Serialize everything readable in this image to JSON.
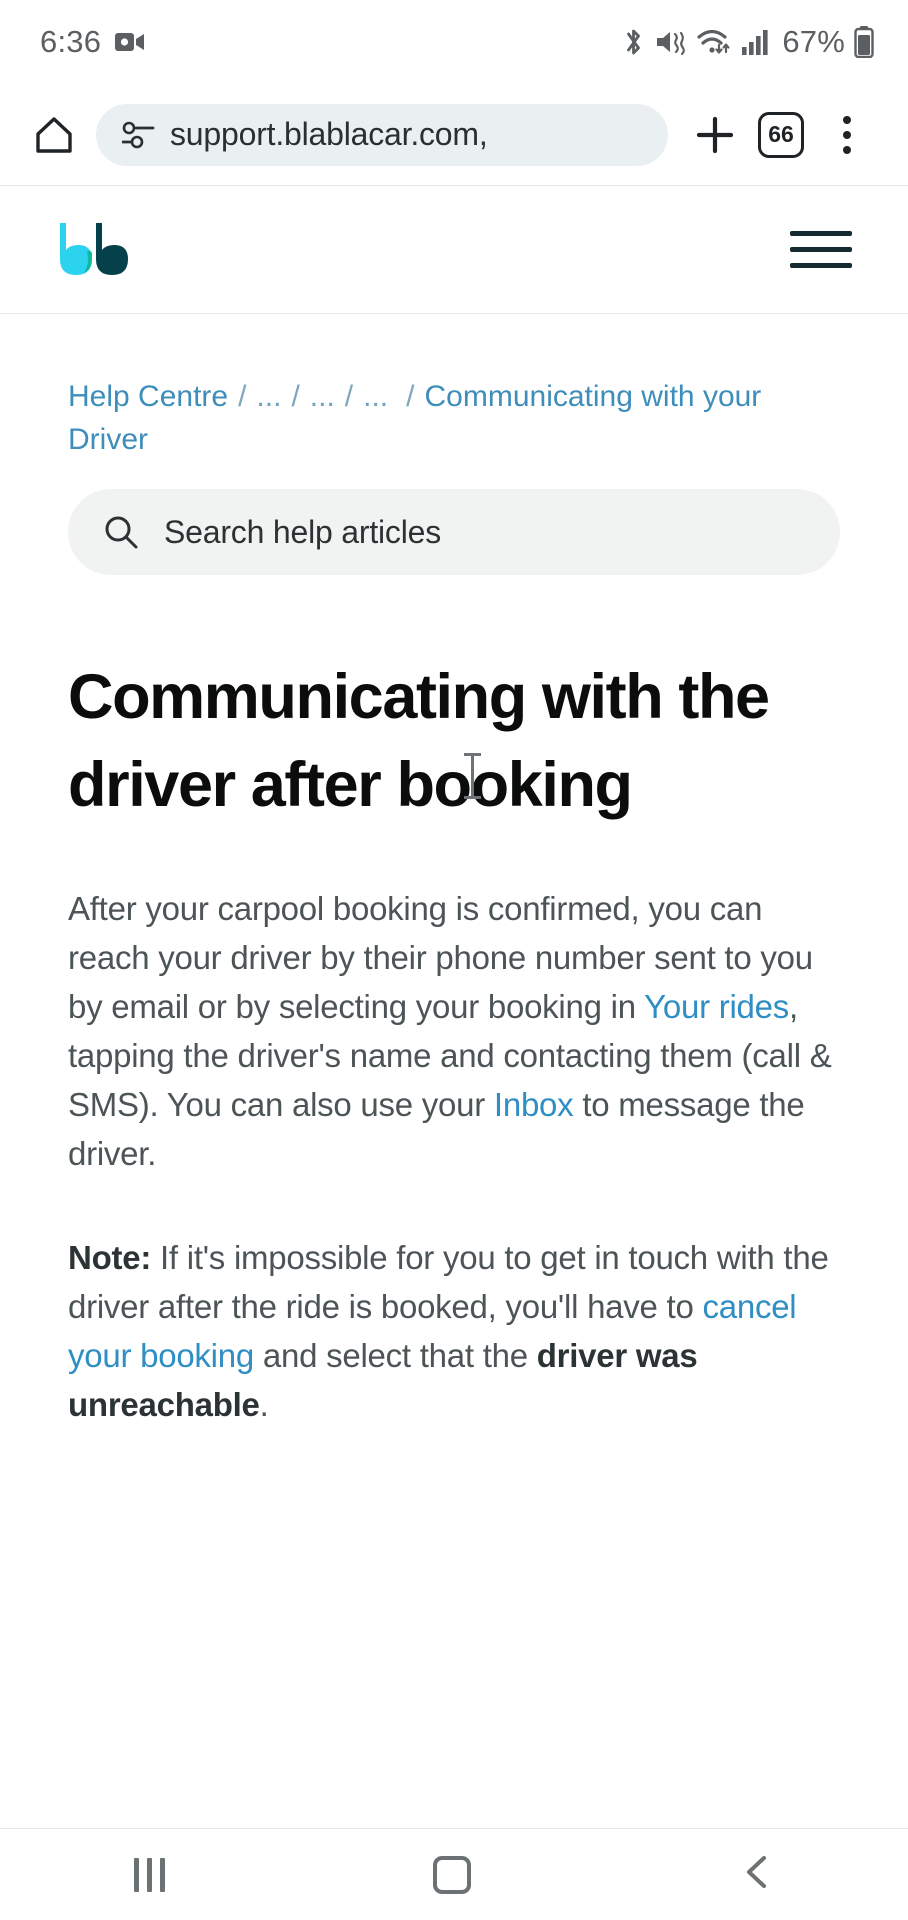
{
  "status_bar": {
    "time": "6:36",
    "battery_text": "67%",
    "icons": [
      "video-camera-icon",
      "bluetooth-icon",
      "mute-vibrate-icon",
      "wifi-icon",
      "signal-bars-icon",
      "battery-icon"
    ]
  },
  "browser": {
    "url": "support.blablacar.com,",
    "tab_count": "66",
    "icons": [
      "home-icon",
      "permission-info-icon",
      "new-tab-plus-icon",
      "tab-switcher-icon",
      "more-options-icon"
    ]
  },
  "site_header": {
    "logo_name": "blablacar-logo",
    "logo_color_primary": "#2bd3ee",
    "logo_color_secondary": "#05404b",
    "menu_label": "hamburger-menu-icon"
  },
  "breadcrumb": {
    "items": [
      {
        "label": "Help Centre"
      },
      {
        "label": "..."
      },
      {
        "label": "..."
      },
      {
        "label": "..."
      },
      {
        "label": "Communicating with your Driver"
      }
    ],
    "separator": "/"
  },
  "search": {
    "placeholder": "Search help articles",
    "icon": "search-icon"
  },
  "article": {
    "title": "Communicating with the driver after booking",
    "paragraph1": {
      "part1": "After your carpool booking is confirmed, you can reach your driver by their phone number sent to you by email or by selecting your booking in ",
      "link1": "Your rides",
      "part2": ", tapping the driver's name and contacting them (call & SMS). You can also use your ",
      "link2": "Inbox",
      "part3": " to message the driver."
    },
    "paragraph2": {
      "bold_lead": "Note:",
      "part1": " If it's impossible for you to get in touch with the driver after the ride is booked, you'll have to ",
      "link1": "cancel your booking",
      "part2": " and select that the ",
      "bold1": "driver was unreachable",
      "part3": "."
    }
  },
  "nav_bar": {
    "recents_label": "recents-button",
    "home_label": "home-button",
    "back_label": "back-button"
  },
  "colors": {
    "link": "#2f8ec4",
    "breadcrumb_link": "#3e8dba",
    "text": "#4c5457",
    "heading": "#0b0c0c",
    "search_bg": "#f1f2f2",
    "url_pill_bg": "#eaf0f1"
  }
}
